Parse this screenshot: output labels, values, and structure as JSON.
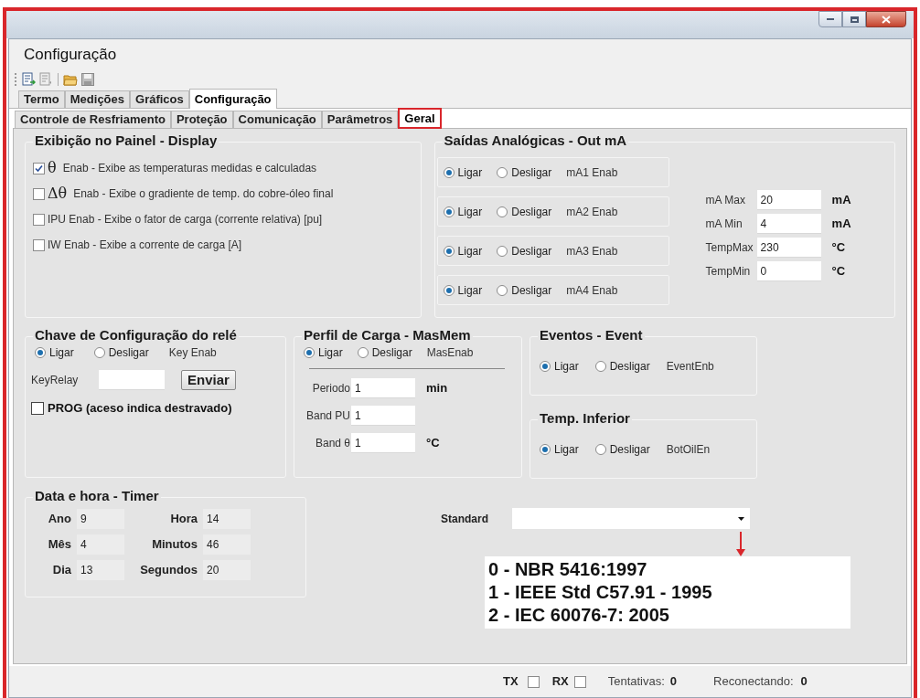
{
  "window": {
    "title": "Configuração",
    "controls": [
      {
        "kind": "minimize"
      },
      {
        "kind": "maximize"
      },
      {
        "kind": "close"
      }
    ]
  },
  "toolbar": [
    {
      "kind": "new",
      "disabled": false
    },
    {
      "kind": "document",
      "disabled": true
    },
    {
      "kind": "open",
      "disabled": false
    },
    {
      "kind": "save",
      "disabled": true
    }
  ],
  "tabs": [
    {
      "label": "Termo",
      "selected": false
    },
    {
      "label": "Medições",
      "selected": false
    },
    {
      "label": "Gráficos",
      "selected": false
    },
    {
      "label": "Configuração",
      "selected": true
    }
  ],
  "subtabs": [
    {
      "label": "Controle de Resfriamento",
      "selected": false,
      "highlighted": false
    },
    {
      "label": "Proteção",
      "selected": false,
      "highlighted": false
    },
    {
      "label": "Comunicação",
      "selected": false,
      "highlighted": false
    },
    {
      "label": "Parâmetros",
      "selected": false,
      "highlighted": false
    },
    {
      "label": "Geral",
      "selected": true,
      "highlighted": true
    }
  ],
  "display": {
    "title": "Exibição no Painel - Display",
    "options": [
      {
        "symbol": "θ",
        "label": "Enab - Exibe as temperaturas medidas  e calculadas",
        "checked": true
      },
      {
        "symbol": "Δθ",
        "label": "Enab - Exibe o gradiente de temp. do cobre-óleo final",
        "checked": false
      },
      {
        "label": "IPU Enab - Exibe o fator de carga (corrente relativa) [pu]",
        "checked": false
      },
      {
        "label": "IW Enab - Exibe a corrente de carga [A]",
        "checked": false
      }
    ]
  },
  "analog_outputs": {
    "title": "Saídas Analógicas - Out mA",
    "channels": [
      {
        "options": [
          {
            "label": "Ligar",
            "selected": true
          },
          {
            "label": "Desligar",
            "selected": false
          }
        ],
        "name": "mA1 Enab"
      },
      {
        "options": [
          {
            "label": "Ligar",
            "selected": true
          },
          {
            "label": "Desligar",
            "selected": false
          }
        ],
        "name": "mA2 Enab"
      },
      {
        "options": [
          {
            "label": "Ligar",
            "selected": true
          },
          {
            "label": "Desligar",
            "selected": false
          }
        ],
        "name": "mA3 Enab"
      },
      {
        "options": [
          {
            "label": "Ligar",
            "selected": true
          },
          {
            "label": "Desligar",
            "selected": false
          }
        ],
        "name": "mA4 Enab"
      }
    ],
    "fields": [
      {
        "label": "mA Max",
        "value": "20",
        "unit": "mA"
      },
      {
        "label": "mA Min",
        "value": "4",
        "unit": "mA"
      },
      {
        "label": "TempMax",
        "value": "230",
        "unit": "°C"
      },
      {
        "label": "TempMin",
        "value": "0",
        "unit": "°C"
      }
    ]
  },
  "relay_key": {
    "title": "Chave de Configuração do relé",
    "options": [
      {
        "label": "Ligar",
        "selected": true
      },
      {
        "label": "Desligar",
        "selected": false
      }
    ],
    "name": "Key Enab",
    "field_label": "KeyRelay",
    "button": "Enviar",
    "prog": {
      "label": "PROG (aceso indica destravado)",
      "checked": false
    }
  },
  "load_profile": {
    "title": "Perfil de Carga - MasMem",
    "options": [
      {
        "label": "Ligar",
        "selected": true
      },
      {
        "label": "Desligar",
        "selected": false
      }
    ],
    "name": "MasEnab",
    "fields": [
      {
        "label": "Periodo",
        "value": "1",
        "unit": "min"
      },
      {
        "label": "Band PU",
        "value": "1"
      },
      {
        "label": "Band θ",
        "value": "1",
        "unit": "°C"
      }
    ]
  },
  "events": {
    "title": "Eventos - Event",
    "options": [
      {
        "label": "Ligar",
        "selected": true
      },
      {
        "label": "Desligar",
        "selected": false
      }
    ],
    "name": "EventEnb"
  },
  "lower_temp": {
    "title": "Temp. Inferior",
    "options": [
      {
        "label": "Ligar",
        "selected": true
      },
      {
        "label": "Desligar",
        "selected": false
      }
    ],
    "name": "BotOilEn"
  },
  "timer": {
    "title": "Data e hora - Timer",
    "fields": [
      {
        "label": "Ano",
        "value": "9"
      },
      {
        "label": "Hora",
        "value": "14"
      },
      {
        "label": "Mês",
        "value": "4"
      },
      {
        "label": "Minutos",
        "value": "46"
      },
      {
        "label": "Dia",
        "value": "13"
      },
      {
        "label": "Segundos",
        "value": "20"
      }
    ]
  },
  "standard": {
    "label": "Standard",
    "list": [
      "0 - NBR 5416:1997",
      "1 - IEEE Std C57.91 - 1995",
      "2 - IEC 60076-7: 2005"
    ]
  },
  "status_bar": {
    "tx": {
      "label": "TX",
      "checked": false
    },
    "rx": {
      "label": "RX",
      "checked": false
    },
    "attempts": {
      "label": "Tentativas:",
      "value": "0"
    },
    "reconnecting": {
      "label": "Reconectando:",
      "value": "0"
    }
  }
}
